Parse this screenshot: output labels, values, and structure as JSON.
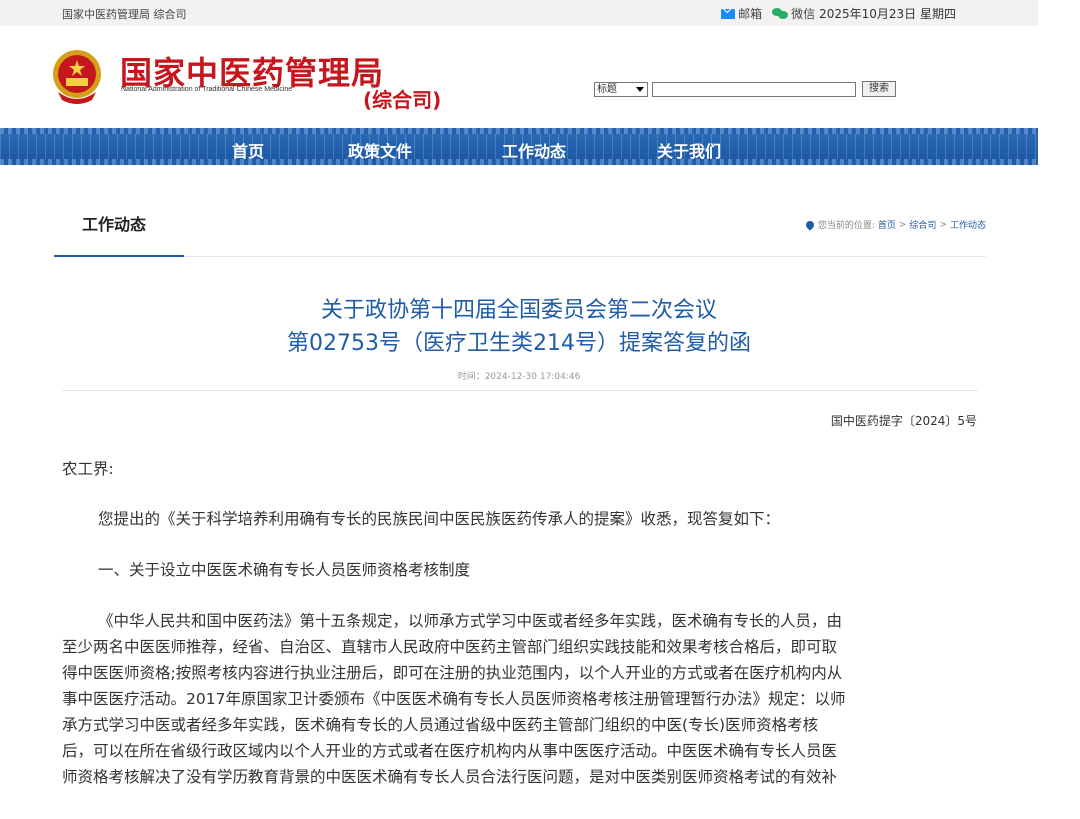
{
  "topbar": {
    "org": "国家中医药管理局 综合司",
    "mail": "邮箱",
    "wechat": "微信",
    "date": "2025年10月23日 星期四"
  },
  "header": {
    "logo_cn": "国家中医药管理局",
    "logo_en": "National Administration of Traditional Chinese Medicine",
    "dept": "(综合司)",
    "search_select": "标题",
    "search_button": "搜索"
  },
  "nav": {
    "items": [
      "首页",
      "政策文件",
      "工作动态",
      "关于我们"
    ]
  },
  "section": {
    "title": "工作动态",
    "breadcrumb_prefix": "您当前的位置:",
    "breadcrumb_home": "首页",
    "breadcrumb_sep1": ">",
    "breadcrumb_dept": "综合司",
    "breadcrumb_sep2": ">",
    "breadcrumb_current": "工作动态"
  },
  "article": {
    "title_line1": "关于政协第十四届全国委员会第二次会议",
    "title_line2": "第02753号（医疗卫生类214号）提案答复的函",
    "time": "时间：2024-12-30 17:04:46",
    "doc_no": "国中医药提字〔2024〕5号",
    "salutation": "农工界:",
    "intro": "您提出的《关于科学培养利用确有专长的民族民间中医民族医药传承人的提案》收悉，现答复如下：",
    "heading1": "一、关于设立中医医术确有专长人员医师资格考核制度",
    "body_lines": [
      "《中华人民共和国中医药法》第十五条规定，以师承方式学习中医或者经多年实践，医术确有专长的人员，由",
      "至少两名中医医师推荐，经省、自治区、直辖市人民政府中医药主管部门组织实践技能和效果考核合格后，即可取",
      "得中医医师资格;按照考核内容进行执业注册后，即可在注册的执业范围内，以个人开业的方式或者在医疗机构内从",
      "事中医医疗活动。2017年原国家卫计委颁布《中医医术确有专长人员医师资格考核注册管理暂行办法》规定：以师",
      "承方式学习中医或者经多年实践，医术确有专长的人员通过省级中医药主管部门组织的中医(专长)医师资格考核",
      "后，可以在所在省级行政区域内以个人开业的方式或者在医疗机构内从事中医医疗活动。中医医术确有专长人员医",
      "师资格考核解决了没有学历教育背景的中医医术确有专长人员合法行医问题，是对中医类别医师资格考试的有效补"
    ]
  }
}
